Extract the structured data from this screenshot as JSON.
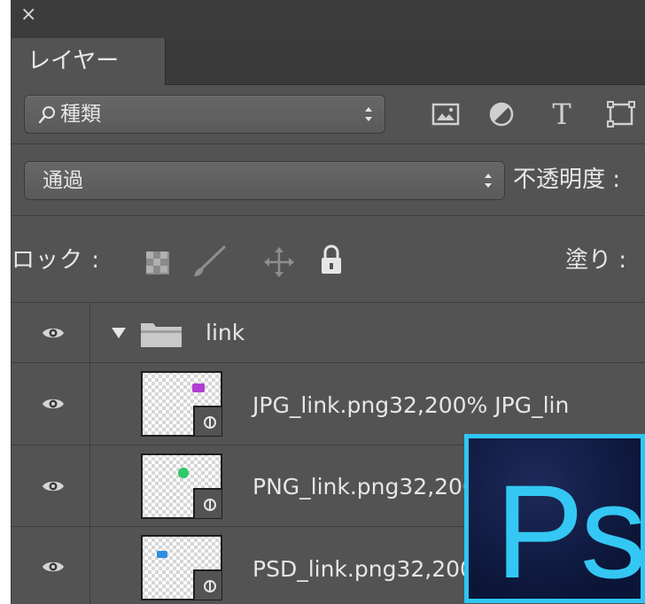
{
  "panel": {
    "close_label": "×",
    "tab_label": "レイヤー"
  },
  "filter": {
    "kind_label": "種類",
    "icons": [
      "image-filter-icon",
      "adjustment-filter-icon",
      "type-filter-icon",
      "shape-filter-icon"
    ],
    "type_icon_glyph": "T"
  },
  "blend": {
    "mode": "通過",
    "opacity_label": "不透明度 :"
  },
  "lock": {
    "label": "ロック :",
    "fill_label": "塗り :"
  },
  "layers": [
    {
      "name": "link",
      "kind": "group",
      "visible": true,
      "expanded": true
    },
    {
      "name": "JPG_link.png32,200% JPG_lin",
      "kind": "linked-smart-object",
      "visible": true,
      "thumb_accent": "#b03fd1"
    },
    {
      "name": "PNG_link.png32,200% PNG_li",
      "kind": "linked-smart-object",
      "visible": true,
      "thumb_accent": "#2fc86b"
    },
    {
      "name": "PSD_link.png32,200% PSD",
      "kind": "linked-smart-object",
      "visible": true,
      "thumb_accent": "#2a8fe0"
    }
  ],
  "badge": {
    "text": "Ps",
    "accent": "#34c7f4",
    "background": "#0b1537"
  },
  "colors": {
    "panel_bg": "#535353",
    "titlebar_bg": "#3c3c3c",
    "text": "#e6e6e6"
  }
}
